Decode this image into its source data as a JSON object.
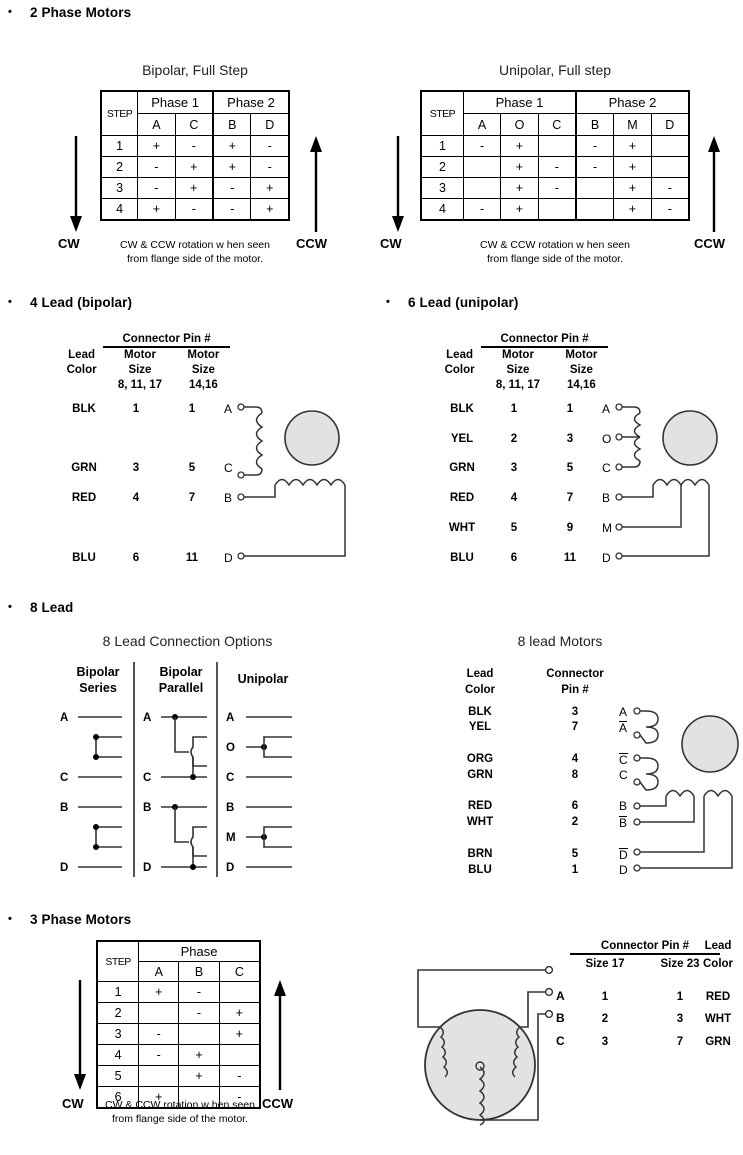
{
  "sections": {
    "two_phase": {
      "bullet": "2 Phase Motors"
    },
    "four_lead": {
      "bullet": "4 Lead (bipolar)"
    },
    "six_lead": {
      "bullet": "6 Lead (unipolar)"
    },
    "eight_lead": {
      "bullet": "8 Lead"
    },
    "three_phase": {
      "bullet": "3 Phase Motors"
    }
  },
  "bipolar_table": {
    "title": "Bipolar, Full Step",
    "step_header": "STEP",
    "phase1": "Phase 1",
    "phase2": "Phase 2",
    "cols": [
      "A",
      "C",
      "B",
      "D"
    ],
    "rows": [
      {
        "step": "1",
        "v": [
          "+",
          "-",
          "+",
          "-"
        ]
      },
      {
        "step": "2",
        "v": [
          "-",
          "+",
          "+",
          "-"
        ]
      },
      {
        "step": "3",
        "v": [
          "-",
          "+",
          "-",
          "+"
        ]
      },
      {
        "step": "4",
        "v": [
          "+",
          "-",
          "-",
          "+"
        ]
      }
    ],
    "cw": "CW",
    "ccw": "CCW",
    "note_line1": "CW & CCW rotation w hen seen",
    "note_line2": "from flange side of the motor."
  },
  "unipolar_table": {
    "title": "Unipolar, Full step",
    "step_header": "STEP",
    "phase1": "Phase 1",
    "phase2": "Phase 2",
    "cols": [
      "A",
      "O",
      "C",
      "B",
      "M",
      "D"
    ],
    "rows": [
      {
        "step": "1",
        "v": [
          "-",
          "+",
          "",
          "-",
          "+",
          ""
        ]
      },
      {
        "step": "2",
        "v": [
          "",
          "+",
          "-",
          "-",
          "+",
          ""
        ]
      },
      {
        "step": "3",
        "v": [
          "",
          "+",
          "-",
          "",
          "+",
          "-"
        ]
      },
      {
        "step": "4",
        "v": [
          "-",
          "+",
          "",
          "",
          "+",
          "-"
        ]
      }
    ],
    "cw": "CW",
    "ccw": "CCW",
    "note_line1": "CW & CCW rotation w hen seen",
    "note_line2": "from flange side of the motor."
  },
  "four_lead": {
    "connector_pin": "Connector Pin #",
    "lead": "Lead",
    "color": "Color",
    "motor": "Motor",
    "size": "Size",
    "size_a": "8, 11, 17",
    "size_b": "14,16",
    "rows": [
      {
        "color": "BLK",
        "pin_a": "1",
        "pin_b": "1",
        "terminal": "A"
      },
      {
        "color": "GRN",
        "pin_a": "3",
        "pin_b": "5",
        "terminal": "C"
      },
      {
        "color": "RED",
        "pin_a": "4",
        "pin_b": "7",
        "terminal": "B"
      },
      {
        "color": "BLU",
        "pin_a": "6",
        "pin_b": "11",
        "terminal": "D"
      }
    ]
  },
  "six_lead": {
    "connector_pin": "Connector Pin #",
    "lead": "Lead",
    "color": "Color",
    "motor": "Motor",
    "size": "Size",
    "size_a": "8, 11, 17",
    "size_b": "14,16",
    "rows": [
      {
        "color": "BLK",
        "pin_a": "1",
        "pin_b": "1",
        "terminal": "A"
      },
      {
        "color": "YEL",
        "pin_a": "2",
        "pin_b": "3",
        "terminal": "O"
      },
      {
        "color": "GRN",
        "pin_a": "3",
        "pin_b": "5",
        "terminal": "C"
      },
      {
        "color": "RED",
        "pin_a": "4",
        "pin_b": "7",
        "terminal": "B"
      },
      {
        "color": "WHT",
        "pin_a": "5",
        "pin_b": "9",
        "terminal": "M"
      },
      {
        "color": "BLU",
        "pin_a": "6",
        "pin_b": "11",
        "terminal": "D"
      }
    ]
  },
  "eight_lead_options": {
    "title": "8 Lead Connection Options",
    "columns": [
      {
        "line1": "Bipolar",
        "line2": "Series",
        "labels": [
          "A",
          "C",
          "B",
          "D"
        ]
      },
      {
        "line1": "Bipolar",
        "line2": "Parallel",
        "labels": [
          "A",
          "C",
          "B",
          "D"
        ]
      },
      {
        "line1": "Unipolar",
        "line2": "",
        "labels": [
          "A",
          "O",
          "C",
          "B",
          "M",
          "D"
        ]
      }
    ]
  },
  "eight_lead_motors": {
    "title": "8 lead Motors",
    "lead": "Lead",
    "color": "Color",
    "connector": "Connector",
    "pin": "Pin #",
    "rows": [
      {
        "color": "BLK",
        "pin": "3",
        "terminal": "A",
        "bar": false
      },
      {
        "color": "YEL",
        "pin": "7",
        "terminal": "A",
        "bar": true
      },
      {
        "color": "ORG",
        "pin": "4",
        "terminal": "C",
        "bar": true
      },
      {
        "color": "GRN",
        "pin": "8",
        "terminal": "C",
        "bar": false
      },
      {
        "color": "RED",
        "pin": "6",
        "terminal": "B",
        "bar": false
      },
      {
        "color": "WHT",
        "pin": "2",
        "terminal": "B",
        "bar": true
      },
      {
        "color": "BRN",
        "pin": "5",
        "terminal": "D",
        "bar": true
      },
      {
        "color": "BLU",
        "pin": "1",
        "terminal": "D",
        "bar": false
      }
    ]
  },
  "three_phase_table": {
    "step_header": "STEP",
    "phase": "Phase",
    "cols": [
      "A",
      "B",
      "C"
    ],
    "rows": [
      {
        "step": "1",
        "v": [
          "+",
          "-",
          ""
        ]
      },
      {
        "step": "2",
        "v": [
          "",
          "-",
          "+"
        ]
      },
      {
        "step": "3",
        "v": [
          "-",
          "",
          "+"
        ]
      },
      {
        "step": "4",
        "v": [
          "-",
          "+",
          ""
        ]
      },
      {
        "step": "5",
        "v": [
          "",
          "+",
          "-"
        ]
      },
      {
        "step": "6",
        "v": [
          "+",
          "",
          "-"
        ]
      }
    ],
    "cw": "CW",
    "ccw": "CCW",
    "note_line1": "CW & CCW rotation w hen seen",
    "note_line2": "from flange side of the motor."
  },
  "three_phase_pins": {
    "connector_pin": "Connector Pin #",
    "lead": "Lead",
    "color": "Color",
    "size17": "Size 17",
    "size23": "Size 23",
    "rows": [
      {
        "terminal": "A",
        "s17": "1",
        "s23": "1",
        "color": "RED"
      },
      {
        "terminal": "B",
        "s17": "2",
        "s23": "3",
        "color": "WHT"
      },
      {
        "terminal": "C",
        "s17": "3",
        "s23": "7",
        "color": "GRN"
      }
    ]
  },
  "colors": {
    "rotor_fill": "#e2e2e2",
    "line": "#222222"
  }
}
